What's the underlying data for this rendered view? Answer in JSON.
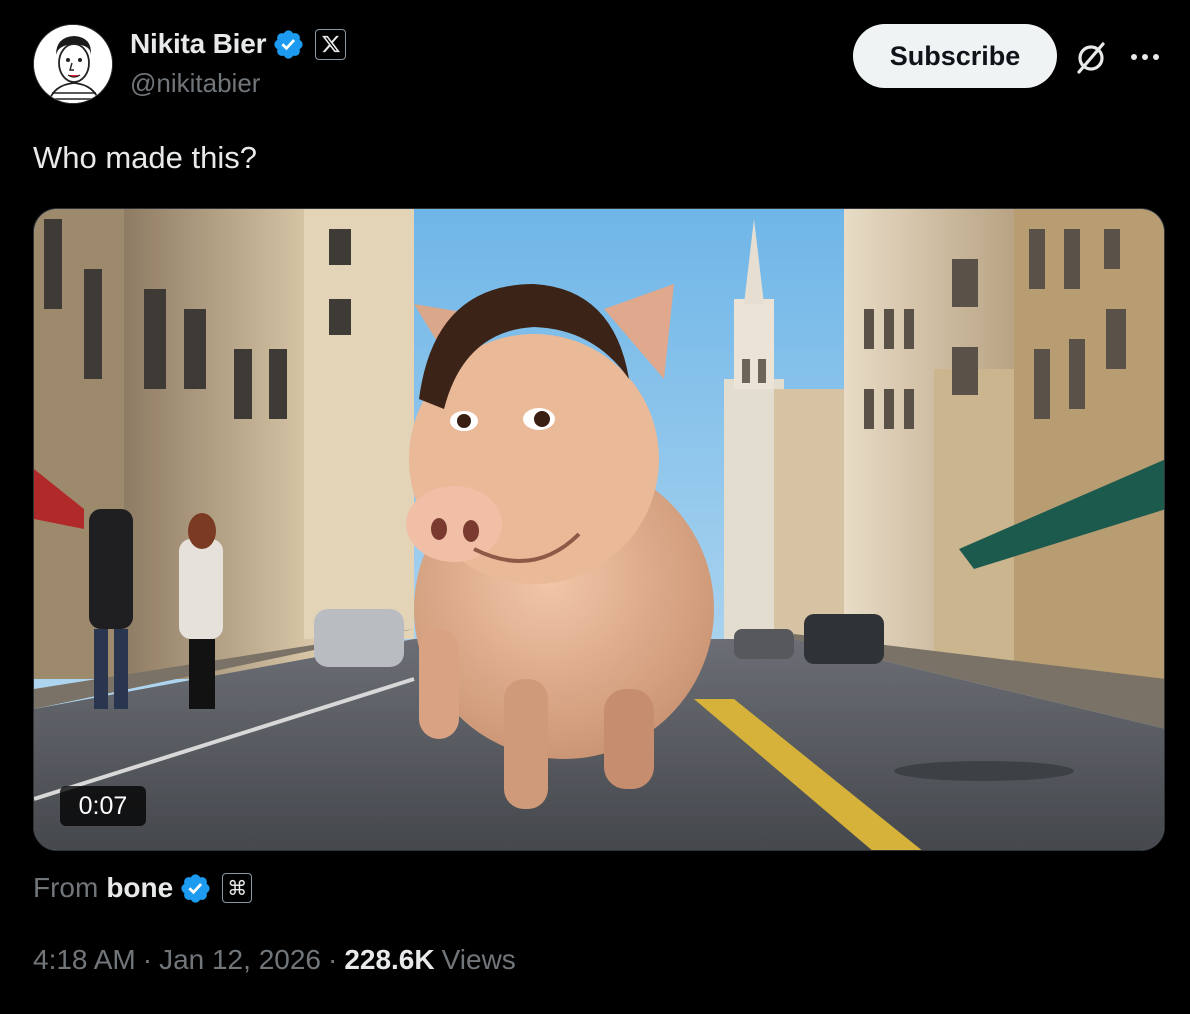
{
  "author": {
    "display_name": "Nikita Bier",
    "handle": "@nikitabier"
  },
  "header": {
    "subscribe_label": "Subscribe"
  },
  "tweet": {
    "text": "Who made this?"
  },
  "media": {
    "duration": "0:07"
  },
  "source": {
    "from_label": "From",
    "name": "bone",
    "badge_glyph": "⌘"
  },
  "meta": {
    "time": "4:18 AM",
    "separator": "·",
    "date": "Jan 12, 2026",
    "views_count": "228.6K",
    "views_label": "Views"
  },
  "icons": {
    "verified": "verified-badge-icon",
    "affiliate": "x-logo-icon",
    "grok": "grok-icon",
    "more": "more-icon"
  },
  "colors": {
    "background": "#000000",
    "text_primary": "#e7e9ea",
    "text_secondary": "#71767b",
    "verified_blue": "#1d9bf0",
    "button_bg": "#eff3f4"
  }
}
